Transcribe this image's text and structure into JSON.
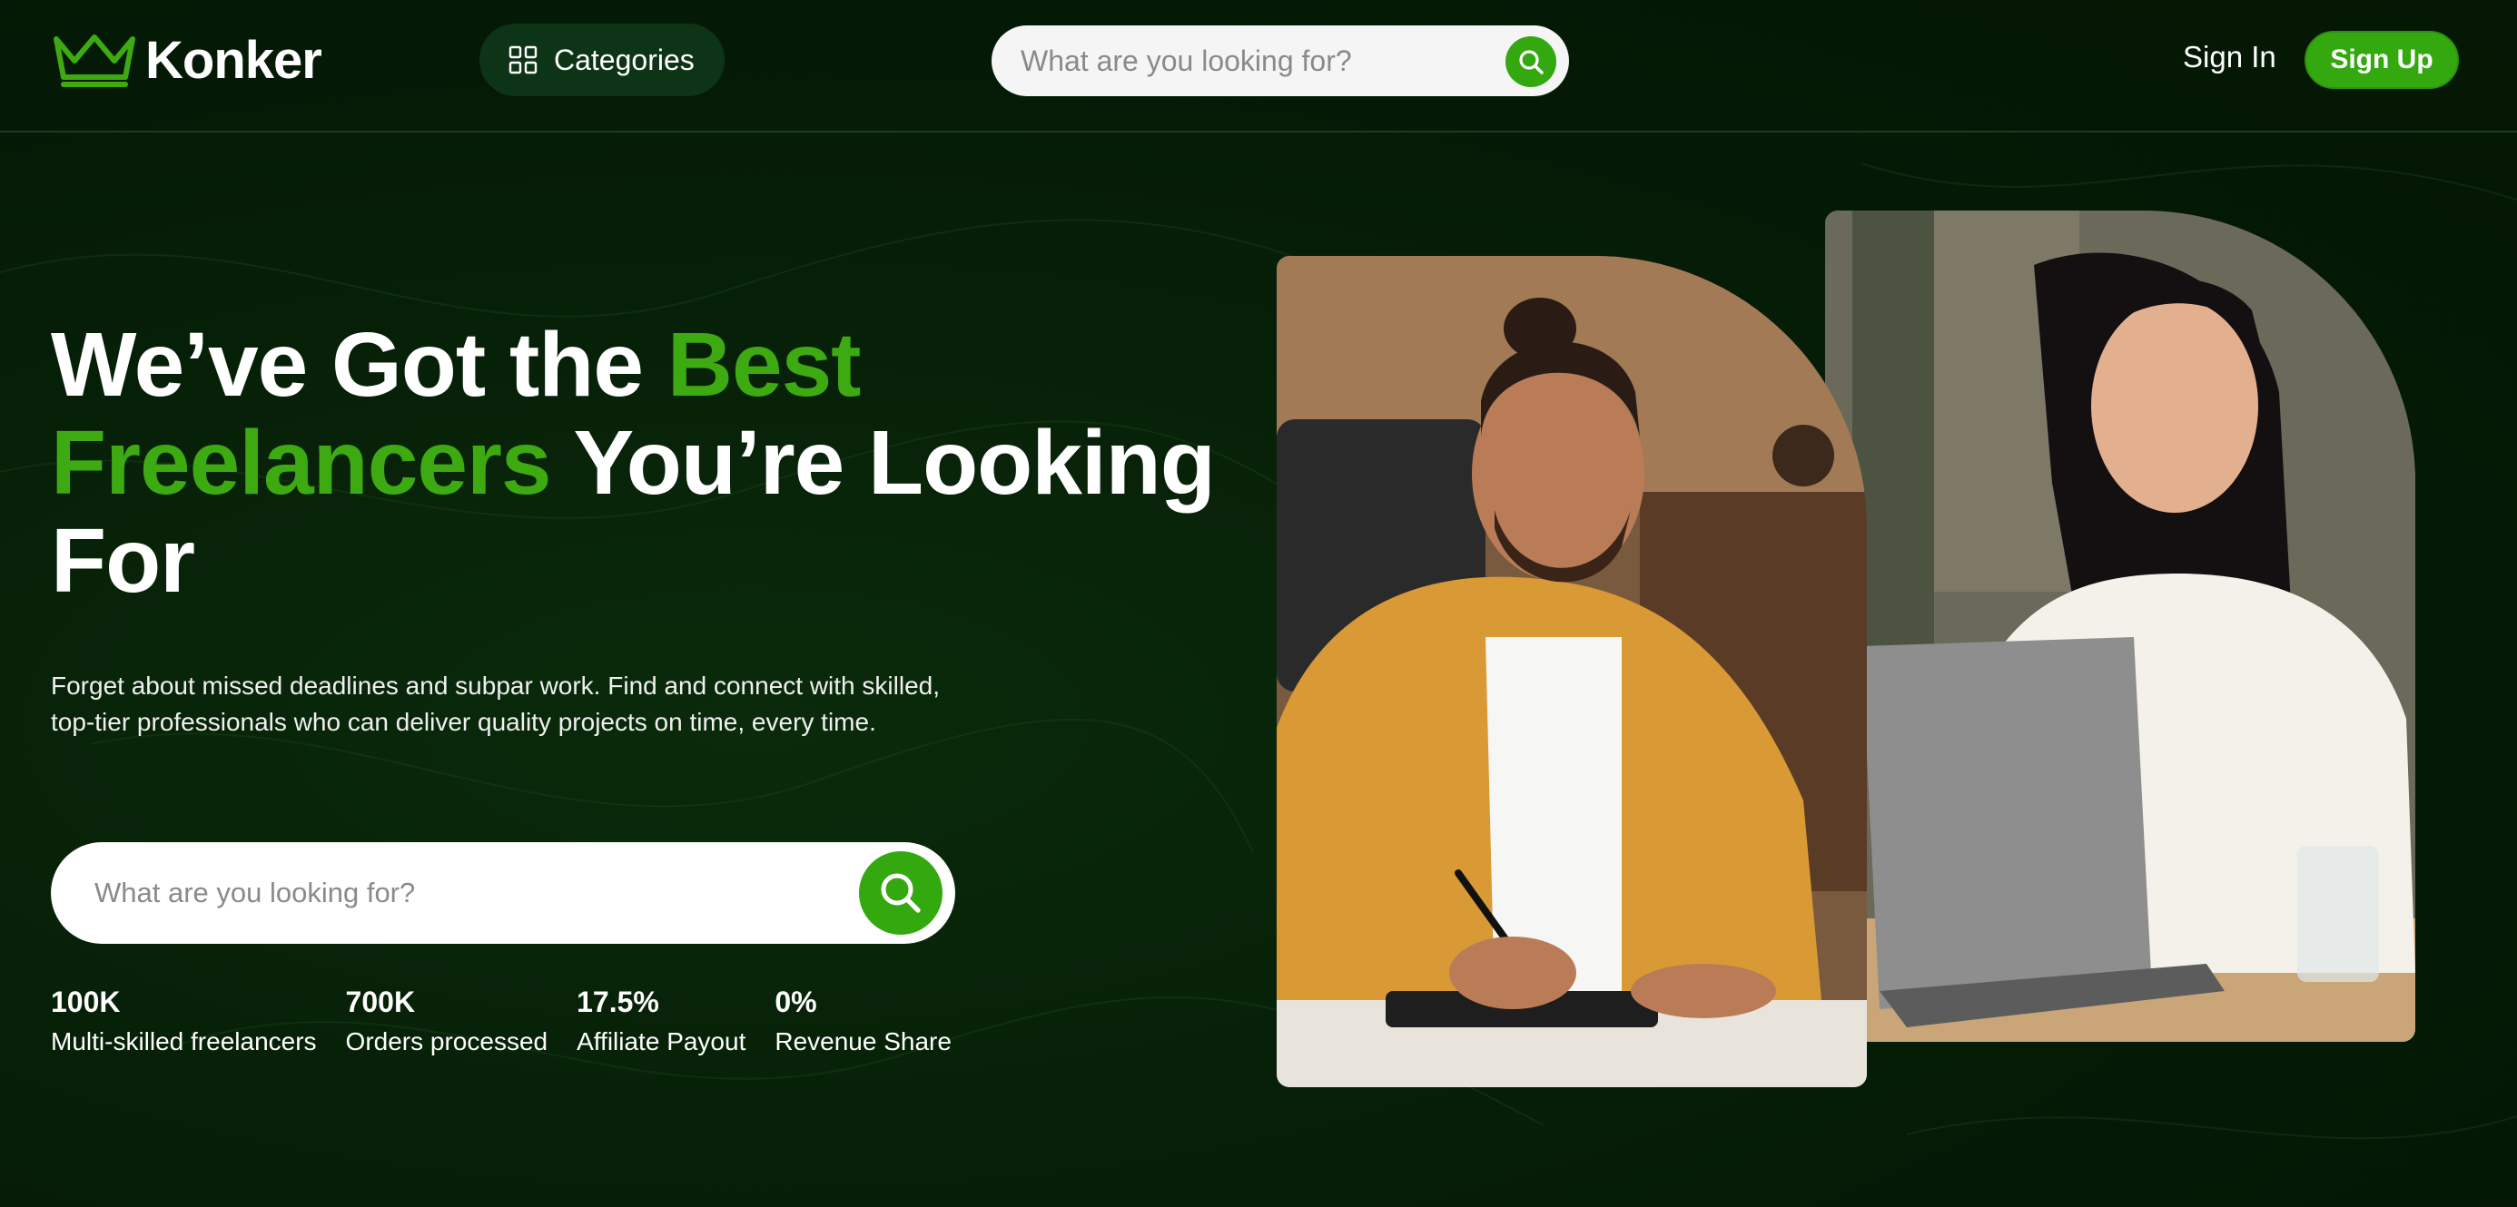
{
  "header": {
    "logo_text": "Konker",
    "categories_label": "Categories",
    "search_placeholder": "What are you looking for?",
    "sign_in_label": "Sign In",
    "sign_up_label": "Sign Up"
  },
  "hero": {
    "headline_part1": "We’ve Got the ",
    "headline_highlight": "Best Freelancers",
    "headline_part2": " You’re Looking For",
    "subtext": "Forget about missed deadlines and subpar work. Find and connect with skilled, top-tier professionals who can deliver quality projects on time, every time.",
    "search_placeholder": "What are you looking for?"
  },
  "stats": [
    {
      "value": "100K",
      "label": "Multi-skilled freelancers"
    },
    {
      "value": "700K",
      "label": "Orders processed"
    },
    {
      "value": "17.5%",
      "label": "Affiliate Payout"
    },
    {
      "value": "0%",
      "label": "Revenue Share"
    }
  ],
  "colors": {
    "background": "#062106",
    "accent_green": "#34a80f",
    "headline_green": "#3daa12",
    "categories_bg": "#0e3417"
  },
  "icons": {
    "logo": "crown-icon",
    "categories": "grid-icon",
    "search": "search-icon"
  }
}
